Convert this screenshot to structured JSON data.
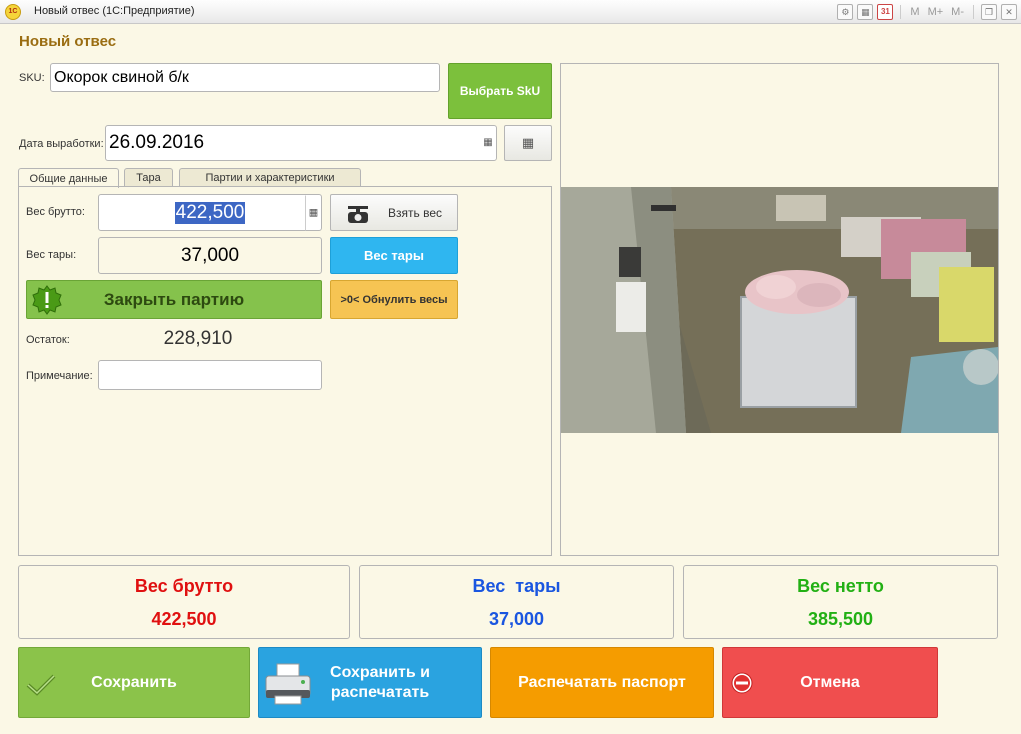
{
  "window": {
    "logo": "1С",
    "title": "Новый отвес  (1С:Предприятие)",
    "toolbar_icons": [
      "settings-icon",
      "calculator-icon",
      "calendar-icon"
    ],
    "calendar_label": "31",
    "memory_labels": [
      "M",
      "M+",
      "M-"
    ]
  },
  "form": {
    "title": "Новый отвес"
  },
  "sku": {
    "label": "SKU:",
    "value": "Окорок свиной б/к",
    "select_button": "Выбрать SkU"
  },
  "production_date": {
    "label": "Дата выработки:",
    "value": "26.09.2016"
  },
  "tabs": [
    {
      "label": "Общие данные",
      "active": true
    },
    {
      "label": "Тара"
    },
    {
      "label": "Партии и характеристики"
    }
  ],
  "general": {
    "gross_label": "Вес брутто:",
    "gross_value": "422,500",
    "take_weight_button": "Взять вес",
    "tare_label": "Вес тары:",
    "tare_value": "37,000",
    "tare_button": "Вес тары",
    "close_party_button": "Закрыть партию",
    "reset_scales_button": ">0< Обнулить весы",
    "remainder_label": "Остаток:",
    "remainder_value": "228,910",
    "note_label": "Примечание:",
    "note_value": ""
  },
  "summary": [
    {
      "title": "Вес брутто",
      "value": "422,500",
      "color": "#e01010"
    },
    {
      "title": "Вес  тары",
      "value": "37,000",
      "color": "#1a56e0"
    },
    {
      "title": "Вес нетто",
      "value": "385,500",
      "color": "#22b014"
    }
  ],
  "actions": {
    "save": "Сохранить",
    "save_print_line1": "Сохранить и",
    "save_print_line2": "распечатать",
    "print_passport": "Распечатать паспорт",
    "cancel": "Отмена"
  },
  "colors": {
    "save": "#8bc34a",
    "save_print": "#2aa3e0",
    "print_passport": "#f59c00",
    "cancel": "#f04e4e",
    "accent_title": "#9a6d12"
  }
}
